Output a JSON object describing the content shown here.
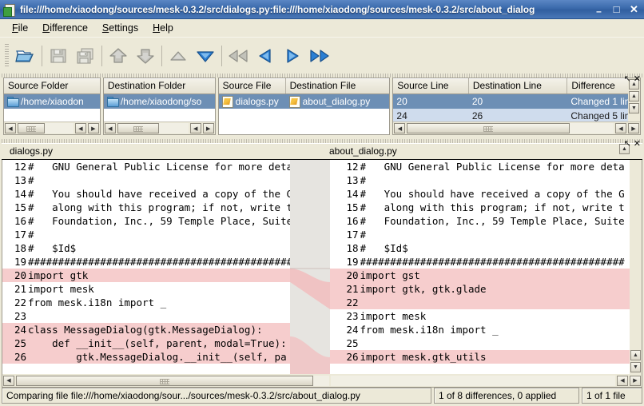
{
  "window": {
    "title": "file:///home/xiaodong/sources/mesk-0.3.2/src/dialogs.py:file:///home/xiaodong/sources/mesk-0.3.2/src/about_dialog",
    "icon": "app-icon",
    "minimize": "–",
    "maximize": "□",
    "close": "✕"
  },
  "menubar": {
    "items": [
      {
        "mnemonic": "F",
        "rest": "ile"
      },
      {
        "mnemonic": "D",
        "rest": "ifference"
      },
      {
        "mnemonic": "S",
        "rest": "ettings"
      },
      {
        "mnemonic": "H",
        "rest": "elp"
      }
    ]
  },
  "toolbar": {
    "buttons": [
      {
        "name": "open-folder-button",
        "icon": "open-folder-icon",
        "enabled": true
      },
      {
        "name": "save-button",
        "icon": "save-icon",
        "enabled": false
      },
      {
        "name": "save-as-button",
        "icon": "save-as-icon",
        "enabled": false
      },
      {
        "name": "apply-up-button",
        "icon": "arrow-up-bold-icon",
        "enabled": false
      },
      {
        "name": "apply-down-button",
        "icon": "arrow-down-bold-icon",
        "enabled": false
      },
      {
        "name": "previous-difference-button",
        "icon": "triangle-up-icon",
        "enabled": false
      },
      {
        "name": "next-difference-button",
        "icon": "triangle-down-icon",
        "enabled": true
      },
      {
        "name": "first-file-button",
        "icon": "rewind-icon",
        "enabled": false
      },
      {
        "name": "previous-file-button",
        "icon": "triangle-left-icon",
        "enabled": true
      },
      {
        "name": "next-file-button",
        "icon": "triangle-right-icon",
        "enabled": true
      },
      {
        "name": "last-file-button",
        "icon": "fast-forward-icon",
        "enabled": true
      }
    ]
  },
  "folder_panels": {
    "source": {
      "header": "Source Folder",
      "row": "/home/xiaodon",
      "icon": "folder-icon"
    },
    "destination": {
      "header": "Destination Folder",
      "row": "/home/xiaodong/so",
      "icon": "folder-icon"
    }
  },
  "file_panel": {
    "headers": [
      "Source File",
      "Destination File"
    ],
    "rows": [
      {
        "source": "dialogs.py",
        "destination": "about_dialog.py",
        "icon": "python-file-icon",
        "selected": true
      }
    ]
  },
  "difference_panel": {
    "headers": [
      "Source Line",
      "Destination Line",
      "Difference"
    ],
    "rows": [
      {
        "source_line": "20",
        "destination_line": "20",
        "difference": "Changed 1 lin",
        "selected": true
      },
      {
        "source_line": "24",
        "destination_line": "26",
        "difference": "Changed 5 lin",
        "selected": false
      }
    ],
    "panel_restore": "↖",
    "panel_close": "✕"
  },
  "diff_view": {
    "left": {
      "filename": "dialogs.py",
      "lines": [
        {
          "no": "12",
          "text": "#   GNU General Public License for more deta",
          "changed": false
        },
        {
          "no": "13",
          "text": "#",
          "changed": false
        },
        {
          "no": "14",
          "text": "#   You should have received a copy of the G",
          "changed": false
        },
        {
          "no": "15",
          "text": "#   along with this program; if not, write t",
          "changed": false
        },
        {
          "no": "16",
          "text": "#   Foundation, Inc., 59 Temple Place, Suite",
          "changed": false
        },
        {
          "no": "17",
          "text": "#",
          "changed": false
        },
        {
          "no": "18",
          "text": "#   $Id$",
          "changed": false
        },
        {
          "no": "19",
          "text": "############################################",
          "changed": false
        },
        {
          "no": "20",
          "text": "import gtk",
          "changed": true
        },
        {
          "no": "21",
          "text": "import mesk",
          "changed": false
        },
        {
          "no": "22",
          "text": "from mesk.i18n import _",
          "changed": false
        },
        {
          "no": "23",
          "text": "",
          "changed": false
        },
        {
          "no": "24",
          "text": "class MessageDialog(gtk.MessageDialog):",
          "changed": true
        },
        {
          "no": "25",
          "text": "    def __init__(self, parent, modal=True):",
          "changed": true
        },
        {
          "no": "26",
          "text": "        gtk.MessageDialog.__init__(self, pa",
          "changed": true
        }
      ]
    },
    "right": {
      "filename": "about_dialog.py",
      "lines": [
        {
          "no": "12",
          "text": "#   GNU General Public License for more deta",
          "changed": false
        },
        {
          "no": "13",
          "text": "#",
          "changed": false
        },
        {
          "no": "14",
          "text": "#   You should have received a copy of the G",
          "changed": false
        },
        {
          "no": "15",
          "text": "#   along with this program; if not, write t",
          "changed": false
        },
        {
          "no": "16",
          "text": "#   Foundation, Inc., 59 Temple Place, Suite",
          "changed": false
        },
        {
          "no": "17",
          "text": "#",
          "changed": false
        },
        {
          "no": "18",
          "text": "#   $Id$",
          "changed": false
        },
        {
          "no": "19",
          "text": "############################################",
          "changed": false
        },
        {
          "no": "20",
          "text": "import gst",
          "changed": true
        },
        {
          "no": "21",
          "text": "import gtk, gtk.glade",
          "changed": true
        },
        {
          "no": "22",
          "text": "",
          "changed": true
        },
        {
          "no": "23",
          "text": "import mesk",
          "changed": false
        },
        {
          "no": "24",
          "text": "from mesk.i18n import _",
          "changed": false
        },
        {
          "no": "25",
          "text": "",
          "changed": false
        },
        {
          "no": "26",
          "text": "import mesk.gtk_utils",
          "changed": true
        }
      ]
    },
    "panel_restore": "↖",
    "panel_close": "✕"
  },
  "statusbar": {
    "comparing": "Comparing file file:///home/xiaodong/sour.../sources/mesk-0.3.2/src/about_dialog.py",
    "differences": "1 of 8 differences, 0 applied",
    "files": "1 of 1 file"
  },
  "colors": {
    "titlebar": "#3a6aab",
    "selection": "#6d8fb5",
    "changed_line": "#f6cdcd",
    "face": "#ece9d8",
    "accent_blue": "#2a6fc4"
  }
}
